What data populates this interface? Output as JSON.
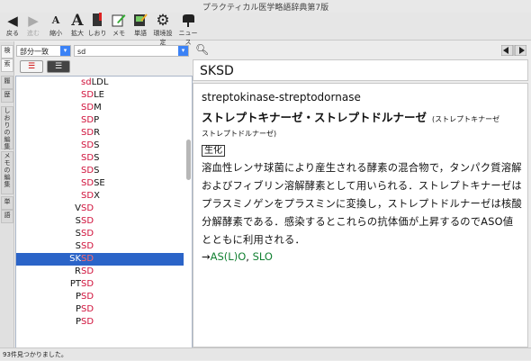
{
  "window": {
    "title": "プラクティカル医学略語辞典第7版"
  },
  "toolbar": {
    "back": "戻る",
    "forward": "進む",
    "shrink": "縮小",
    "enlarge": "拡大",
    "bookmark": "しおり",
    "memo": "メモ",
    "vocab": "単語",
    "settings": "環境設定",
    "news": "ニュース"
  },
  "sidebar_tabs": [
    "検",
    "索",
    "履",
    "歴",
    "しおりの編集",
    "メモの編集",
    "単",
    "語"
  ],
  "search": {
    "mode": "部分一致",
    "query": "sd"
  },
  "results": [
    {
      "pre": "",
      "match": "sd",
      "post": "LDL"
    },
    {
      "pre": "",
      "match": "SD",
      "post": "LE"
    },
    {
      "pre": "",
      "match": "SD",
      "post": "M"
    },
    {
      "pre": "",
      "match": "SD",
      "post": "P"
    },
    {
      "pre": "",
      "match": "SD",
      "post": "R"
    },
    {
      "pre": "",
      "match": "SD",
      "post": "S"
    },
    {
      "pre": "",
      "match": "SD",
      "post": "S"
    },
    {
      "pre": "",
      "match": "SD",
      "post": "S"
    },
    {
      "pre": "",
      "match": "SD",
      "post": "SE"
    },
    {
      "pre": "",
      "match": "SD",
      "post": "X"
    },
    {
      "pre": "V",
      "match": "SD",
      "post": ""
    },
    {
      "pre": "S",
      "match": "SD",
      "post": ""
    },
    {
      "pre": "S",
      "match": "SD",
      "post": ""
    },
    {
      "pre": "S",
      "match": "SD",
      "post": ""
    },
    {
      "pre": "SK",
      "match": "SD",
      "post": ""
    },
    {
      "pre": "R",
      "match": "SD",
      "post": ""
    },
    {
      "pre": "PT",
      "match": "SD",
      "post": ""
    },
    {
      "pre": "P",
      "match": "SD",
      "post": ""
    },
    {
      "pre": "P",
      "match": "SD",
      "post": ""
    },
    {
      "pre": "P",
      "match": "SD",
      "post": ""
    }
  ],
  "selected_result": "SKSD",
  "entry": {
    "headword": "SKSD",
    "english": "streptokinase-streptodornase",
    "japanese": "ストレプトキナーゼ・ストレプトドルナーゼ",
    "reading1": "(ストレプトキナーゼ",
    "reading2": "ストレプトドルナーゼ)",
    "category": "生化",
    "body": "溶血性レンサ球菌により産生される酵素の混合物で，タンパク質溶解およびフィブリン溶解酵素として用いられる．ストレプトキナーゼはプラスミノゲンをプラスミンに変換し，ストレプトドルナーゼは核酸分解酵素である．感染するとこれらの抗体価が上昇するのでASO値とともに利用される．",
    "arrow": "→",
    "see_also": [
      "AS(L)O",
      "SLO"
    ],
    "see_also_sep": ", "
  },
  "status": "93件見つかりました。",
  "colors": {
    "match": "#d0103a",
    "selection": "#2b64c8",
    "link": "#128032"
  }
}
